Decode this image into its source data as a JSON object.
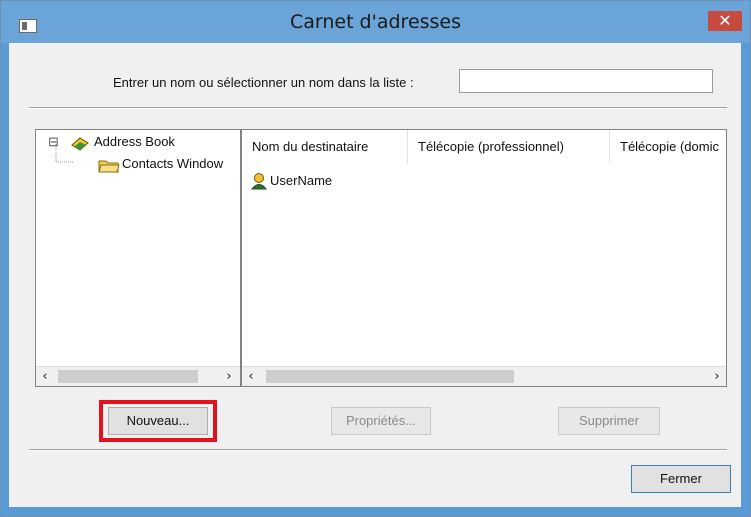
{
  "window": {
    "title": "Carnet d'adresses",
    "close_label": "✕"
  },
  "search": {
    "label": "Entrer un nom ou sélectionner un nom dans la liste :",
    "value": ""
  },
  "tree": {
    "root_label": "Address Book",
    "child_label": "Contacts Window",
    "expander": "⊟"
  },
  "list": {
    "columns": [
      "Nom du destinataire",
      "Télécopie (professionnel)",
      "Télécopie (domic"
    ],
    "rows": [
      {
        "name": "UserName"
      }
    ]
  },
  "scroll": {
    "left": "‹",
    "right": "›"
  },
  "buttons": {
    "new": "Nouveau...",
    "properties": "Propriétés...",
    "delete": "Supprimer",
    "close": "Fermer"
  },
  "colors": {
    "titlebar": "#6aa4d8",
    "close": "#c74a3f",
    "highlight": "#e3121c"
  }
}
